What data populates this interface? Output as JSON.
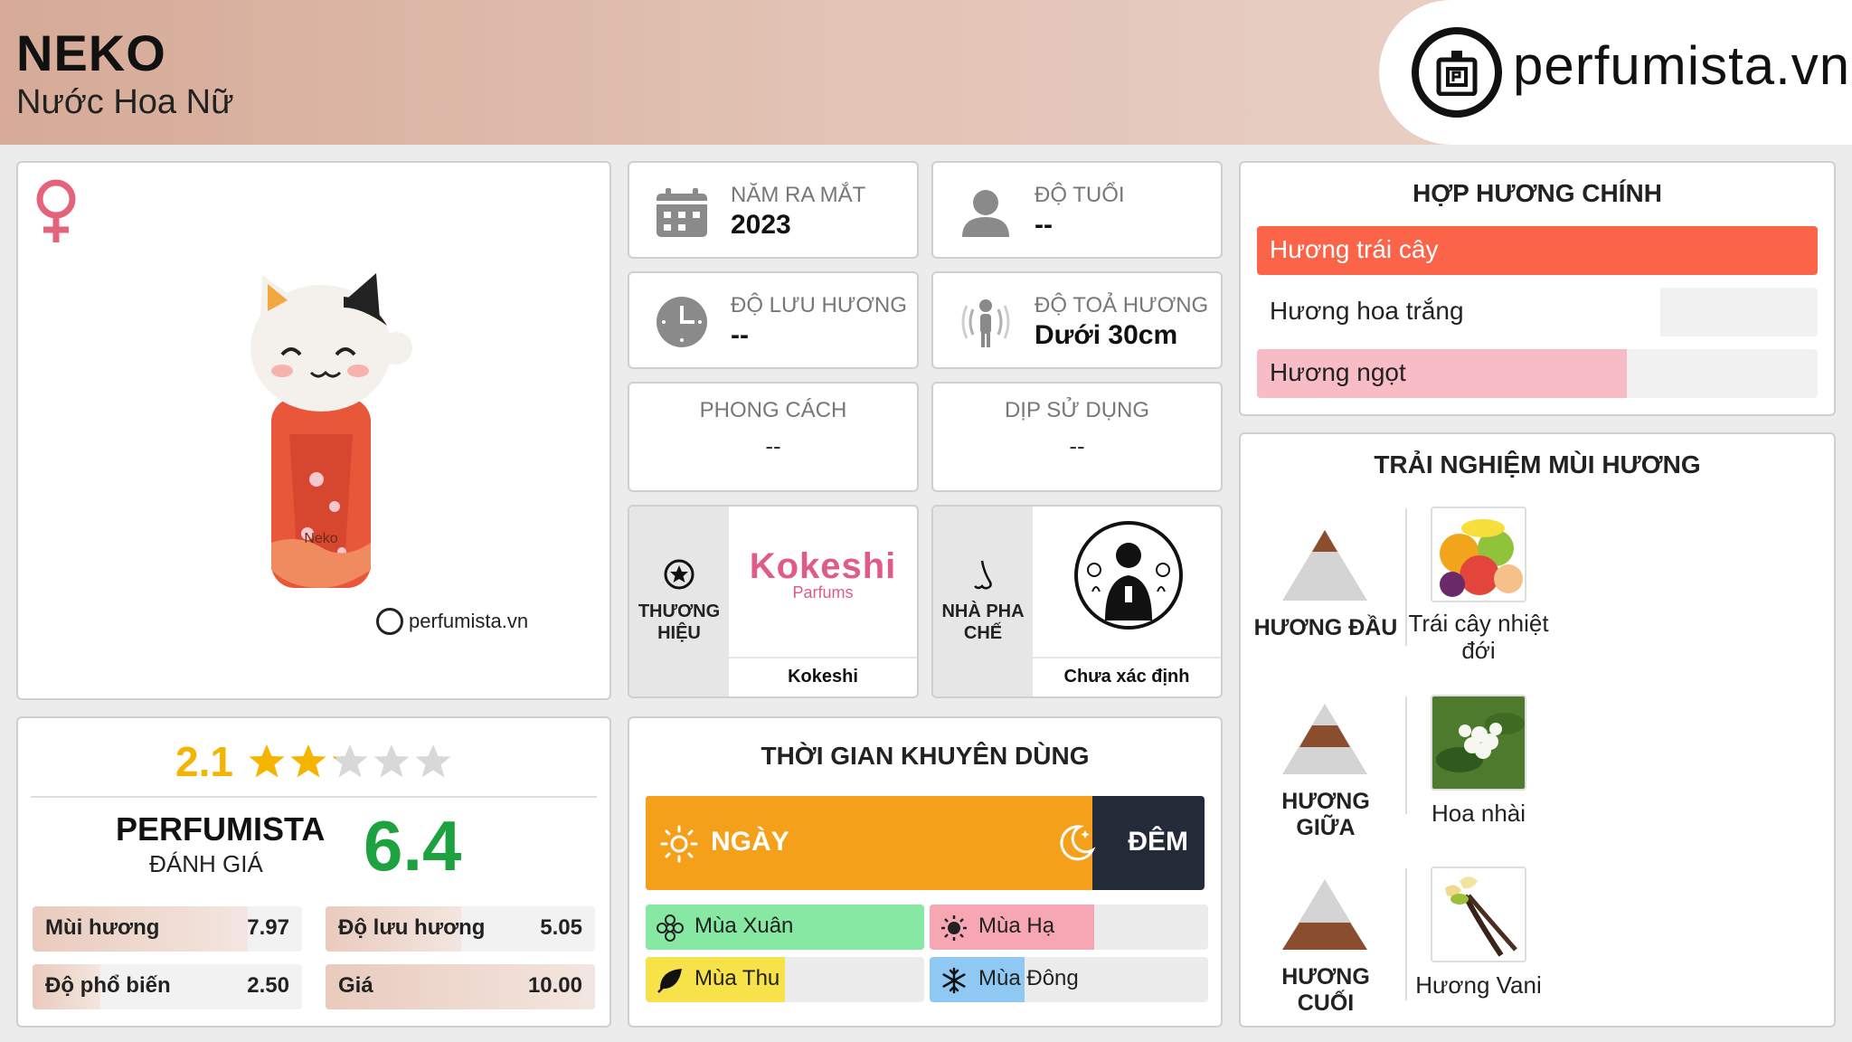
{
  "header": {
    "title": "NEKO",
    "subtitle": "Nước Hoa Nữ",
    "logo_text": "perfumista.vn"
  },
  "product": {
    "watermark": "perfumista.vn",
    "gender_icon": "female-symbol-icon",
    "bottle_text": "Neko"
  },
  "rating": {
    "score": "2.1",
    "stars_filled": 2.1,
    "stars_total": 5,
    "perfumista_label": "PERFUMISTA",
    "perfumista_sub": "ĐÁNH GIÁ",
    "perfumista_score": "6.4",
    "items": [
      {
        "label": "Mùi hương",
        "value": "7.97",
        "fraction": 0.797
      },
      {
        "label": "Độ lưu hương",
        "value": "5.05",
        "fraction": 0.505
      },
      {
        "label": "Độ phổ biến",
        "value": "2.50",
        "fraction": 0.25
      },
      {
        "label": "Giá",
        "value": "10.00",
        "fraction": 1.0
      }
    ]
  },
  "info": {
    "year": {
      "label": "NĂM RA MẮT",
      "value": "2023"
    },
    "age": {
      "label": "ĐỘ TUỔI",
      "value": "--"
    },
    "longevity": {
      "label": "ĐỘ LƯU HƯƠNG",
      "value": "--"
    },
    "sillage": {
      "label": "ĐỘ TOẢ HƯƠNG",
      "value": "Dưới 30cm"
    },
    "style": {
      "label": "PHONG CÁCH",
      "value": "--"
    },
    "occasion": {
      "label": "DỊP SỬ DỤNG",
      "value": "--"
    }
  },
  "brand": {
    "label": "THƯƠNG HIỆU",
    "logo_main": "Kokeshi",
    "logo_sub": "Parfums",
    "name": "Kokeshi"
  },
  "perfumer": {
    "label": "NHÀ PHA CHẾ",
    "name": "Chưa xác định"
  },
  "time": {
    "title": "THỜI GIAN KHUYÊN DÙNG",
    "day_label": "NGÀY",
    "night_label": "ĐÊM",
    "day_fraction": 0.8,
    "seasons": [
      {
        "label": "Mùa Xuân",
        "fraction": 1.0,
        "color": "#86e8a3",
        "icon": "flower-icon"
      },
      {
        "label": "Mùa Hạ",
        "fraction": 0.59,
        "color": "#f6a7b3",
        "icon": "sun-icon"
      },
      {
        "label": "Mùa Thu",
        "fraction": 0.5,
        "color": "#f7e24a",
        "icon": "leaf-icon"
      },
      {
        "label": "Mùa Đông",
        "fraction": 0.34,
        "color": "#8fc8f2",
        "icon": "snowflake-icon"
      }
    ]
  },
  "accords": {
    "title": "HỢP HƯƠNG CHÍNH",
    "items": [
      {
        "label": "Hương trái cây",
        "fraction": 1.0,
        "color": "#fb6449"
      },
      {
        "label": "Hương hoa trắng",
        "fraction": 0.72,
        "color": "#ffffff"
      },
      {
        "label": "Hương ngọt",
        "fraction": 0.66,
        "color": "#f8bcc6"
      }
    ]
  },
  "notes": {
    "title": "TRẢI NGHIỆM MÙI HƯƠNG",
    "top": {
      "label": "HƯƠNG ĐẦU",
      "item": "Trái cây nhiệt đới"
    },
    "middle": {
      "label": "HƯƠNG GIỮA",
      "item": "Hoa nhài"
    },
    "base": {
      "label": "HƯƠNG CUỐI",
      "item": "Hương Vani"
    }
  },
  "colors": {
    "accent_orange": "#f5a01a",
    "night_dark": "#232a38",
    "score_green": "#1ea23f",
    "star_gold": "#f5b400",
    "gender_pink": "#e2637a"
  }
}
